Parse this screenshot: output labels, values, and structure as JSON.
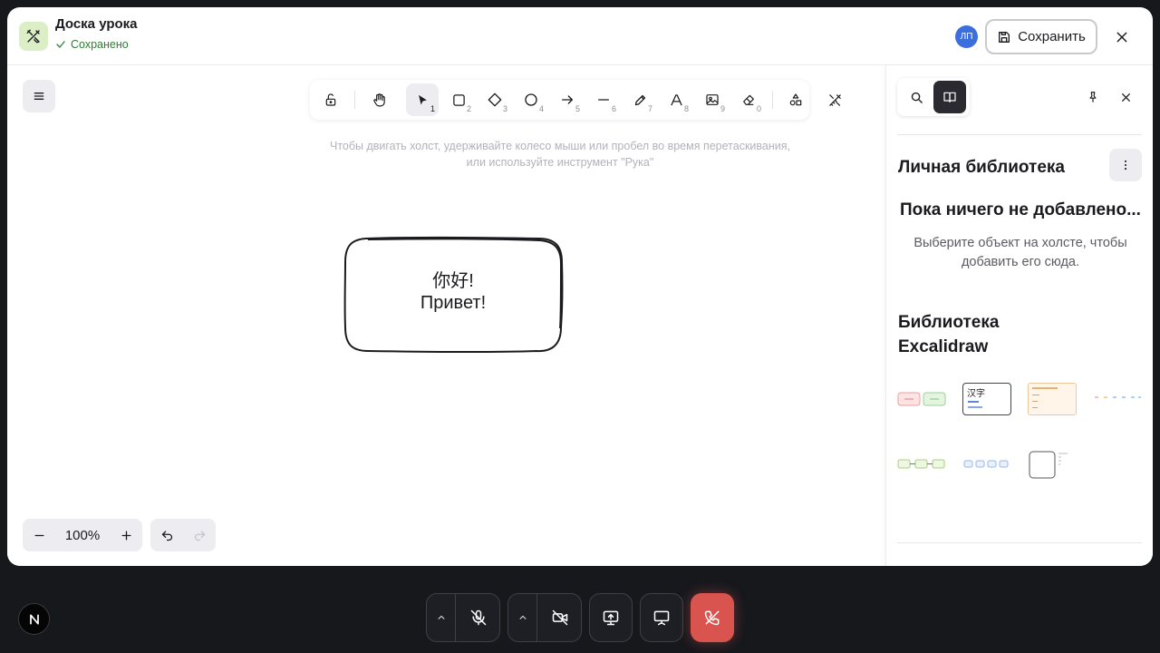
{
  "header": {
    "title": "Доска урока",
    "status": "Сохранено",
    "avatar_initials": "ЛП",
    "save_label": "Сохранить"
  },
  "toolbar": {
    "tools": [
      {
        "name": "lock",
        "icon": "lock-open-icon",
        "key": ""
      },
      {
        "name": "hand",
        "icon": "hand-icon",
        "key": ""
      },
      {
        "name": "selection",
        "icon": "pointer-icon",
        "key": "1",
        "active": true
      },
      {
        "name": "rectangle",
        "icon": "square-icon",
        "key": "2"
      },
      {
        "name": "diamond",
        "icon": "diamond-icon",
        "key": "3"
      },
      {
        "name": "ellipse",
        "icon": "circle-icon",
        "key": "4"
      },
      {
        "name": "arrow",
        "icon": "arrow-right-icon",
        "key": "5"
      },
      {
        "name": "line",
        "icon": "line-icon",
        "key": "6"
      },
      {
        "name": "draw",
        "icon": "pencil-icon",
        "key": "7"
      },
      {
        "name": "text",
        "icon": "text-icon",
        "key": "8"
      },
      {
        "name": "image",
        "icon": "image-icon",
        "key": "9"
      },
      {
        "name": "eraser",
        "icon": "eraser-icon",
        "key": "0"
      },
      {
        "name": "extra",
        "icon": "shapes-icon",
        "key": ""
      }
    ]
  },
  "canvas": {
    "hint_line1": "Чтобы двигать холст, удерживайте колесо мыши или пробел во время перетаскивания,",
    "hint_line2": "или используйте инструмент \"Рука\"",
    "shape_text_line1": "你好!",
    "shape_text_line2": "Привет!"
  },
  "zoom": {
    "value": "100%"
  },
  "sidebar": {
    "personal_title": "Личная библиотека",
    "empty_title": "Пока ничего не добавлено...",
    "empty_desc": "Выберите объект на холсте, чтобы добавить его сюда.",
    "excalidraw_title": "Библиотека Excalidraw",
    "item3_text": "汉字"
  },
  "colors": {
    "background": "#16181c",
    "accent_green": "#2e7d32",
    "avatar_blue": "#3b6fe0",
    "hangup_red": "#d9534f",
    "tab_active": "#2a2a30"
  }
}
